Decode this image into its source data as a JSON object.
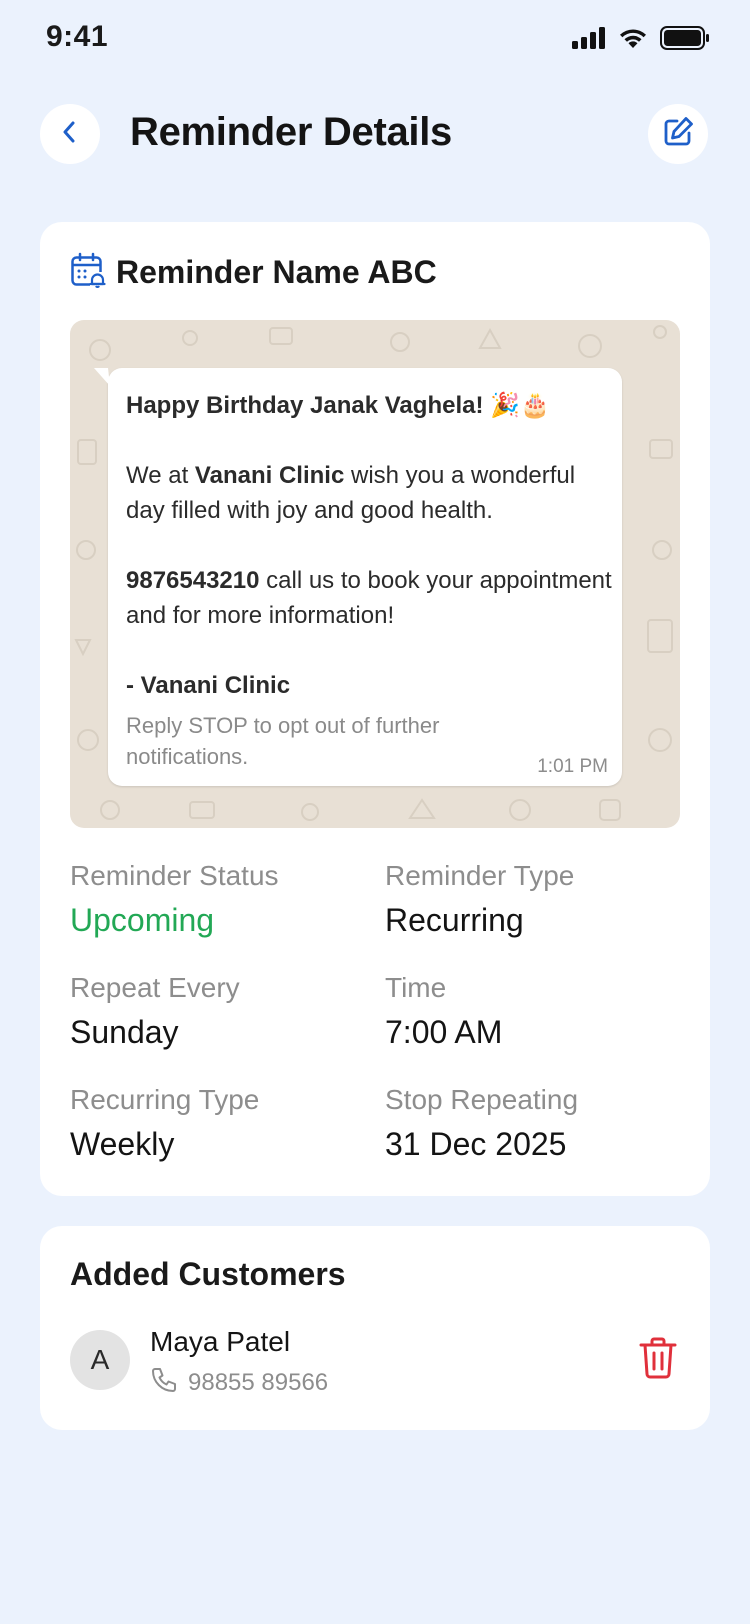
{
  "status_bar": {
    "time": "9:41",
    "icons": [
      "cellular-signal-icon",
      "wifi-icon",
      "battery-icon"
    ]
  },
  "header": {
    "title": "Reminder Details",
    "back_icon": "chevron-left-icon",
    "edit_icon": "edit-pencil-icon"
  },
  "reminder": {
    "name": "Reminder Name ABC",
    "icon": "calendar-bell-icon",
    "message": {
      "greeting": "Happy Birthday Janak Vaghela! 🎉🎂",
      "line1_prefix": "We at ",
      "clinic": "Vanani Clinic",
      "line1_suffix": " wish you a wonderful day filled with joy and good health.",
      "phone": "9876543210",
      "line2_suffix": " call us to book your appointment and for more information!",
      "signature_prefix": "- ",
      "signature": "Vanani Clinic",
      "optout": "Reply STOP to opt out of further notifications.",
      "time": "1:01 PM"
    },
    "details": [
      {
        "label": "Reminder Status",
        "value": "Upcoming"
      },
      {
        "label": "Reminder Type",
        "value": "Recurring"
      },
      {
        "label": "Repeat Every",
        "value": "Sunday"
      },
      {
        "label": "Time",
        "value": "7:00 AM"
      },
      {
        "label": "Recurring Type",
        "value": "Weekly"
      },
      {
        "label": "Stop Repeating",
        "value": "31 Dec 2025"
      }
    ]
  },
  "customers": {
    "title": "Added Customers",
    "items": [
      {
        "initial": "A",
        "name": "Maya Patel",
        "phone": "98855 89566"
      }
    ]
  },
  "colors": {
    "background": "#ebf2fd",
    "accent": "#1e5fc9",
    "status_upcoming": "#22a855",
    "delete": "#e0303b",
    "chat_background": "#e8e0d5"
  }
}
